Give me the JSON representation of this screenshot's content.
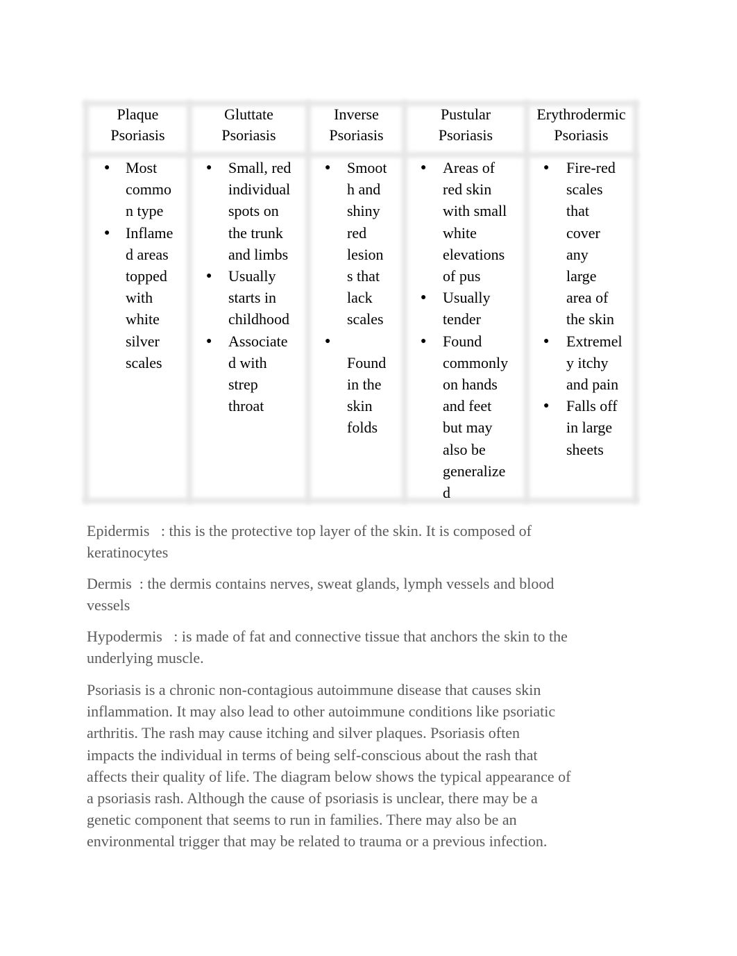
{
  "table": {
    "columns": [
      {
        "header": [
          "Plaque",
          "Psoriasis"
        ],
        "items": [
          [
            "Most",
            "commo",
            "n type"
          ],
          [
            "Inflame",
            "d areas",
            "topped",
            "with",
            "white",
            "silver",
            "scales"
          ]
        ]
      },
      {
        "header": [
          "Gluttate",
          "Psoriasis"
        ],
        "items": [
          [
            "Small, red",
            "individual",
            "spots on",
            "the trunk",
            "and limbs"
          ],
          [
            "Usually",
            "starts in",
            "childhood"
          ],
          [
            "Associate",
            "d with",
            "strep",
            "throat"
          ]
        ]
      },
      {
        "header": [
          "Inverse",
          "Psoriasis"
        ],
        "items": [
          [
            "Smoot",
            "h and",
            "shiny",
            "red",
            "lesion",
            "s that",
            "lack",
            "scales"
          ],
          [
            "",
            "Found",
            "in the",
            "skin",
            "folds"
          ]
        ]
      },
      {
        "header": [
          "Pustular",
          "Psoriasis"
        ],
        "items": [
          [
            "Areas of",
            "red skin",
            "with small",
            "white",
            "elevations",
            "of pus"
          ],
          [
            "Usually",
            "tender"
          ],
          [
            "Found",
            "commonly",
            "on hands",
            "and feet",
            "but may",
            "also be",
            "generalize",
            "d"
          ]
        ]
      },
      {
        "header": [
          "Erythrodermic",
          "Psoriasis"
        ],
        "items": [
          [
            "Fire-red",
            "scales",
            "that",
            "cover",
            "any",
            "large",
            "area of",
            "the skin"
          ],
          [
            "Extremel",
            "y itchy",
            "and pain"
          ],
          [
            "Falls off",
            "in large",
            "sheets"
          ]
        ]
      }
    ]
  },
  "definitions": [
    {
      "lines": [
        "Epidermis   : this is the protective top layer of the skin. It is composed of",
        "keratinocytes"
      ]
    },
    {
      "lines": [
        "Dermis  : the dermis contains nerves, sweat glands, lymph vessels and blood",
        "vessels"
      ]
    },
    {
      "lines": [
        "Hypodermis   : is made of fat and connective tissue that anchors the skin to the",
        "underlying muscle."
      ]
    }
  ],
  "paragraph": {
    "lines": [
      "Psoriasis is a chronic non-contagious autoimmune disease that causes skin",
      "inflammation. It may also lead to other autoimmune conditions like psoriatic",
      "arthritis. The rash may cause itching and silver plaques. Psoriasis often",
      "impacts the individual in terms of being self-conscious about the rash that",
      "affects their quality of life. The diagram below shows the typical appearance of",
      "a psoriasis rash. Although the cause of psoriasis is unclear, there may be a",
      "genetic component that seems to run in families. There may also be an",
      "environmental trigger that may be related to trauma or a previous infection."
    ]
  }
}
